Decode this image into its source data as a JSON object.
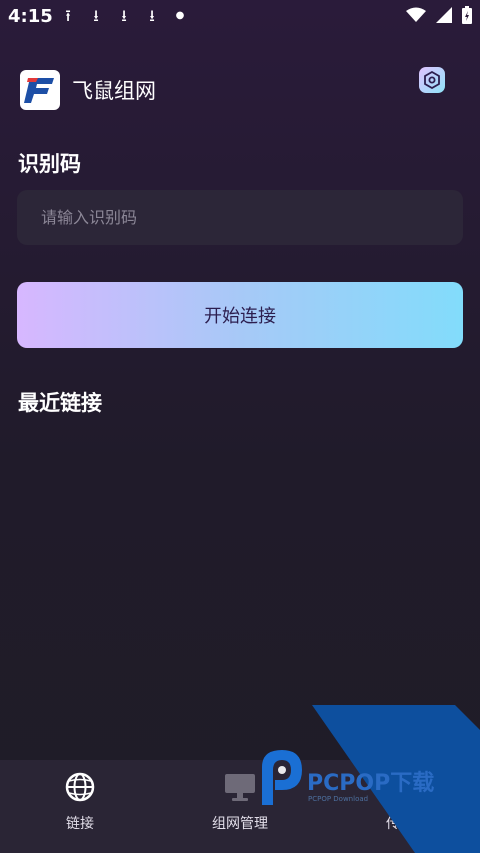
{
  "status_bar": {
    "time": "4:15"
  },
  "app": {
    "title": "飞鼠组网"
  },
  "id_section": {
    "title": "识别码",
    "input_placeholder": "请输入识别码",
    "input_value": ""
  },
  "connect_button": {
    "label": "开始连接"
  },
  "recent": {
    "title": "最近链接"
  },
  "bottom_nav": {
    "items": [
      {
        "label": "链接",
        "icon": "globe-link-icon"
      },
      {
        "label": "组网管理",
        "icon": "monitor-icon"
      },
      {
        "label": "传输",
        "icon": "transfer-icon"
      }
    ]
  },
  "watermark": {
    "text": "PCPOP下载",
    "subtext": "PCPOP Download"
  },
  "colors": {
    "accent_start": "#d7b7ff",
    "accent_end": "#82dcfb",
    "watermark_blue": "#0d4f9e"
  }
}
